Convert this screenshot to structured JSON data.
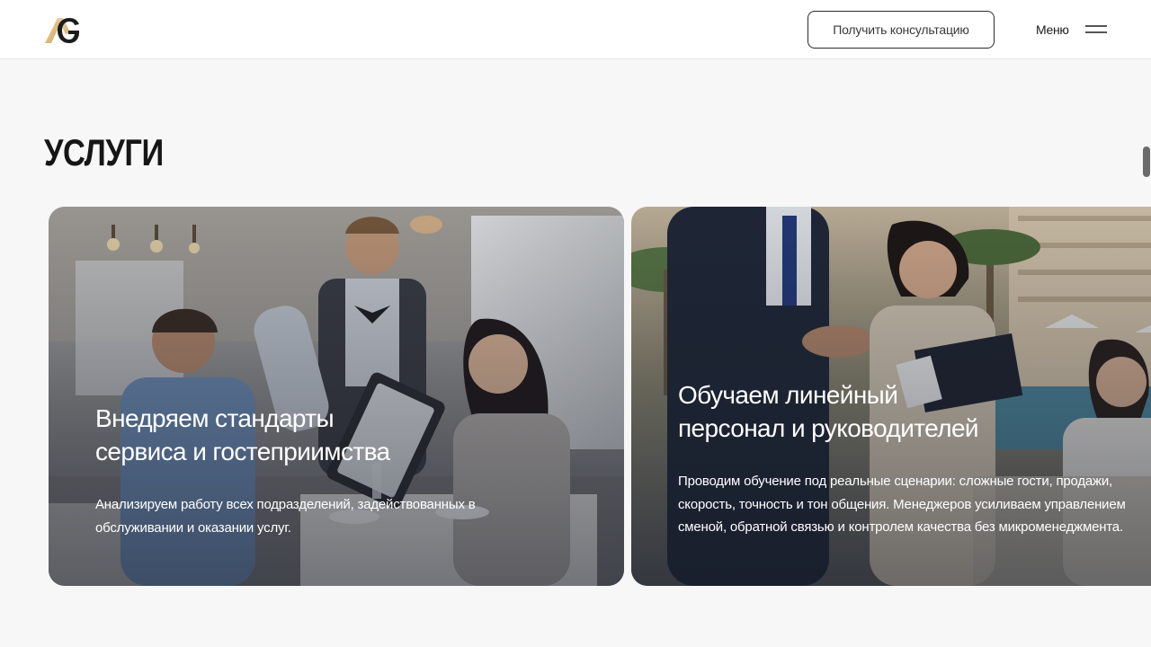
{
  "header": {
    "logo_icon": "ag-logo-icon",
    "consult_button_label": "Получить консультацию",
    "menu_label": "Меню",
    "menu_icon": "hamburger-icon"
  },
  "section": {
    "title": "УСЛУГИ"
  },
  "cards": [
    {
      "title": "Внедряем стандарты\nсервиса и гостеприимства",
      "text": "Анализируем работу всех подразделений, задействованных в\nобслуживании и оказании услуг.",
      "image_subject": "restaurant-waiter-serving-guests"
    },
    {
      "title": "Обучаем линейный\nперсонал и руководителей",
      "text": "Проводим обучение под реальные сценарии: сложные гости, продажи,\nскорость, точность и тон общения. Менеджеров усиливаем управлением\nсменой, обратной связью и контролем качества без микроменеджмента.",
      "image_subject": "hotel-staff-training-outdoors"
    }
  ],
  "colors": {
    "background": "#f7f7f7",
    "header": "#ffffff",
    "text_dark": "#161616",
    "logo_gold": "#d9b77a",
    "logo_dark": "#1c1c1c"
  }
}
